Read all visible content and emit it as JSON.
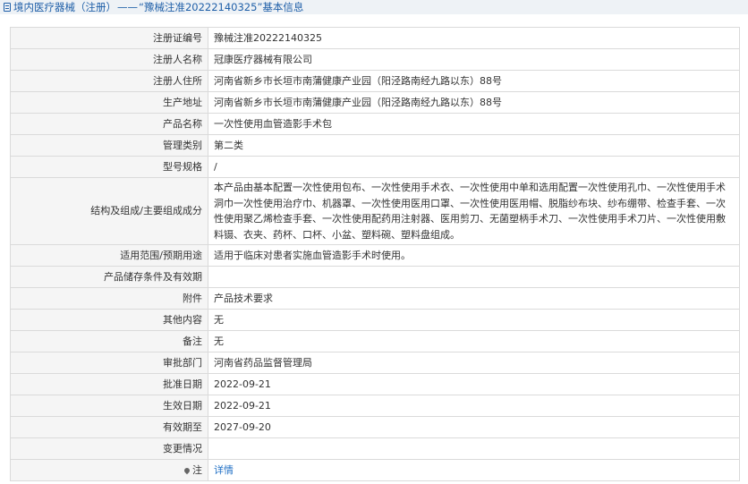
{
  "header": {
    "breadcrumb_root": "境内医疗器械（注册）",
    "separator": "——",
    "record_title": "“豫械注准20222140325”",
    "section": "基本信息"
  },
  "rows": [
    {
      "label": "注册证编号",
      "value": "豫械注准20222140325"
    },
    {
      "label": "注册人名称",
      "value": "冠康医疗器械有限公司"
    },
    {
      "label": "注册人住所",
      "value": "河南省新乡市长垣市南蒲健康产业园（阳泾路南经九路以东）88号"
    },
    {
      "label": "生产地址",
      "value": "河南省新乡市长垣市南蒲健康产业园（阳泾路南经九路以东）88号"
    },
    {
      "label": "产品名称",
      "value": "一次性使用血管造影手术包"
    },
    {
      "label": "管理类别",
      "value": "第二类"
    },
    {
      "label": "型号规格",
      "value": "/"
    },
    {
      "label": "结构及组成/主要组成成分",
      "value": "本产品由基本配置一次性使用包布、一次性使用手术衣、一次性使用中单和选用配置一次性使用孔巾、一次性使用手术洞巾一次性使用治疗巾、机器罩、一次性使用医用口罩、一次性使用医用帽、脱脂纱布块、纱布绷带、检查手套、一次性使用聚乙烯检查手套、一次性使用配药用注射器、医用剪刀、无菌塑柄手术刀、一次性使用手术刀片、一次性使用敷料镊、衣夹、药杯、口杯、小盆、塑料碗、塑料盘组成。"
    },
    {
      "label": "适用范围/预期用途",
      "value": "适用于临床对患者实施血管造影手术时使用。"
    },
    {
      "label": "产品储存条件及有效期",
      "value": ""
    },
    {
      "label": "附件",
      "value": "产品技术要求"
    },
    {
      "label": "其他内容",
      "value": "无"
    },
    {
      "label": "备注",
      "value": "无"
    },
    {
      "label": "审批部门",
      "value": "河南省药品监督管理局"
    },
    {
      "label": "批准日期",
      "value": "2022-09-21"
    },
    {
      "label": "生效日期",
      "value": "2022-09-21"
    },
    {
      "label": "有效期至",
      "value": "2027-09-20"
    },
    {
      "label": "变更情况",
      "value": ""
    },
    {
      "label": "注",
      "value": "详情"
    }
  ],
  "colors": {
    "link": "#1f6fc5",
    "header_bg": "#eef2f6",
    "label_bg": "#f5f5f5",
    "border": "#dadada"
  },
  "icons": {
    "header": "document-icon",
    "note": "pin-icon"
  }
}
